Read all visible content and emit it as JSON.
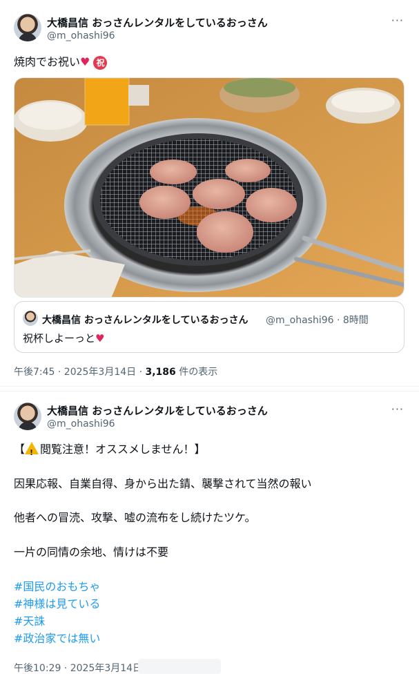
{
  "tweet1": {
    "display_name": "大橋昌信 おっさんレンタルをしているおっさん",
    "handle": "@m_ohashi96",
    "more": "···",
    "text": "焼肉でお祝い",
    "heart_glyph": "♥",
    "iwai_glyph": "祝",
    "quote": {
      "display_name": "大橋昌信 おっさんレンタルをしているおっさん",
      "handle_time": "@m_ohashi96 · 8時間",
      "text": "祝杯しよーっと",
      "heart_glyph": "♥"
    },
    "meta_time": "午後7:45 · 2025年3月14日 · ",
    "views_count": "3,186",
    "views_label": " 件の表示"
  },
  "tweet2": {
    "display_name": "大橋昌信 おっさんレンタルをしているおっさん",
    "handle": "@m_ohashi96",
    "more": "···",
    "line1_open": "【",
    "line1_rest": "閲覧注意！オススメしません！】",
    "line2": "因果応報、自業自得、身から出た錆、襲撃されて当然の報い",
    "line3": "他者への冒涜、攻撃、嘘の流布をし続けたツケ。",
    "line4": "一片の同情の余地、情けは不要",
    "hashtags": [
      "#国民のおもちゃ",
      "#神様は見ている",
      "#天誅",
      "#政治家では無い"
    ],
    "meta_time": "午後10:29 · 2025年3月14日"
  },
  "colors": {
    "link": "#1d9bf0",
    "secondary": "#536471",
    "heart": "#e0245e"
  },
  "icons": {
    "more": "more-icon",
    "warning": "warning-icon"
  }
}
